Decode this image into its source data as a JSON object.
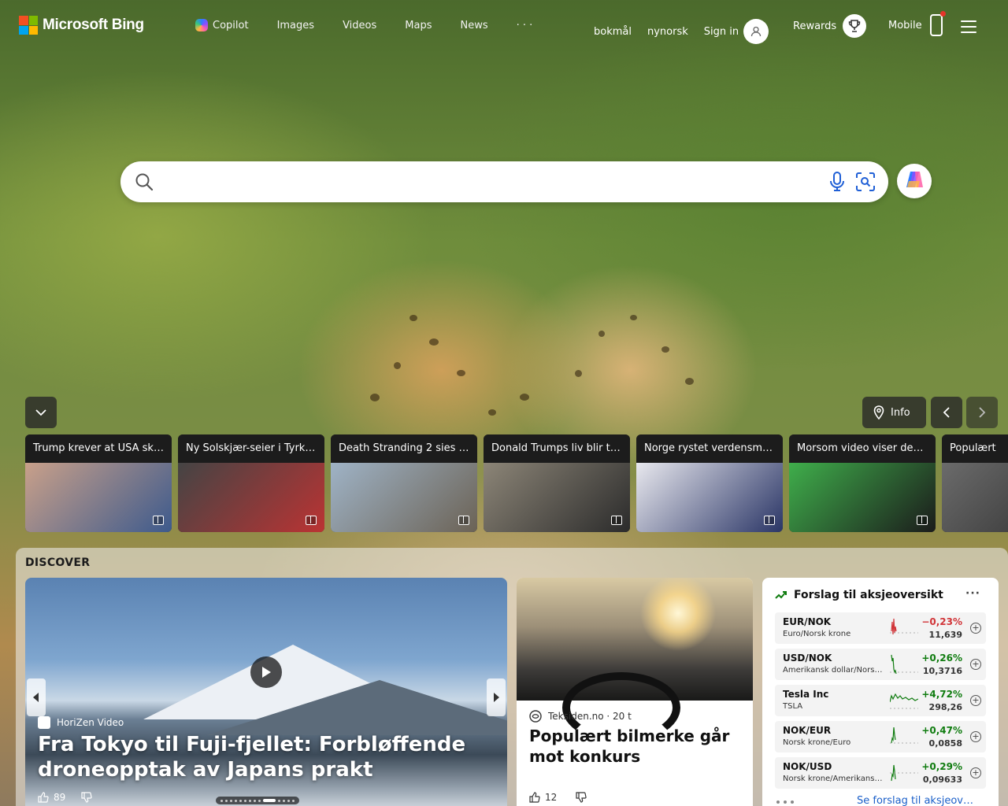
{
  "header": {
    "brand": "Microsoft Bing",
    "nav": [
      {
        "label": "Copilot",
        "icon": "copilot-icon"
      },
      {
        "label": "Images"
      },
      {
        "label": "Videos"
      },
      {
        "label": "Maps"
      },
      {
        "label": "News"
      },
      {
        "label": "· · ·"
      }
    ],
    "lang": [
      "bokmål",
      "nynorsk"
    ],
    "sign_in": "Sign in",
    "rewards": "Rewards",
    "mobile": "Mobile"
  },
  "search": {
    "value": "",
    "placeholder": ""
  },
  "controls": {
    "info": "Info"
  },
  "tiles": [
    {
      "title": "Trump krever at USA sk…",
      "colors": [
        "#c9a08a",
        "#3d5a8c"
      ]
    },
    {
      "title": "Ny Solskjær-seier i Tyrk…",
      "colors": [
        "#444",
        "#b33"
      ]
    },
    {
      "title": "Death Stranding 2 sies …",
      "colors": [
        "#9fb3c6",
        "#6b6255"
      ]
    },
    {
      "title": "Donald Trumps liv blir t…",
      "colors": [
        "#8c8577",
        "#2b2b2b"
      ]
    },
    {
      "title": "Norge rystet verdensm…",
      "colors": [
        "#e8e8ee",
        "#2a3566"
      ]
    },
    {
      "title": "Morsom video viser de…",
      "colors": [
        "#3fae4b",
        "#1b1b1b"
      ]
    },
    {
      "title": "Populært",
      "colors": [
        "#6b6b6b",
        "#2d2d2d"
      ]
    }
  ],
  "discover": {
    "label": "DISCOVER",
    "hero": {
      "source": "HoriZen Video",
      "title": "Fra Tokyo til Fuji-fjellet: Forbløffende droneopptak av Japans prakt",
      "likes": "89"
    },
    "card2": {
      "source": "Teksiden.no · 20 t",
      "title": "Populært bilmerke går mot konkurs",
      "likes": "12"
    },
    "stocks": {
      "title": "Forslag til aksjeoversikt",
      "more": "···",
      "link": "Se forslag til aksjeov…",
      "rows": [
        {
          "symbol": "EUR/NOK",
          "name": "Euro/Norsk krone",
          "change": "−0,23%",
          "price": "11,639",
          "color": "#d13438"
        },
        {
          "symbol": "USD/NOK",
          "name": "Amerikansk dollar/Norsk krone",
          "change": "+0,26%",
          "price": "10,3716",
          "color": "#107c10"
        },
        {
          "symbol": "Tesla Inc",
          "name": "TSLA",
          "change": "+4,72%",
          "price": "298,26",
          "color": "#107c10"
        },
        {
          "symbol": "NOK/EUR",
          "name": "Norsk krone/Euro",
          "change": "+0,47%",
          "price": "0,0858",
          "color": "#107c10"
        },
        {
          "symbol": "NOK/USD",
          "name": "Norsk krone/Amerikansk dollar",
          "change": "+0,29%",
          "price": "0,09633",
          "color": "#107c10"
        }
      ]
    }
  }
}
